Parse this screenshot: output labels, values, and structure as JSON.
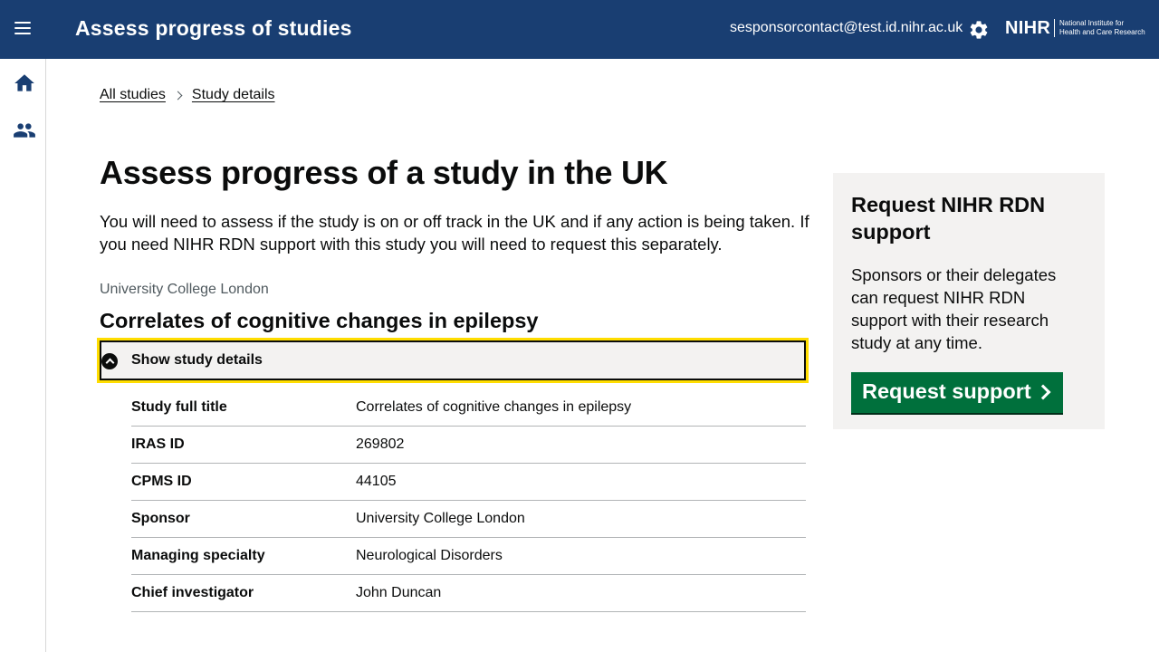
{
  "header": {
    "app_title": "Assess progress of studies",
    "user_email": "sesponsorcontact@test.id.nihr.ac.uk",
    "logo_text": "NIHR",
    "logo_subtitle_line1": "National Institute for",
    "logo_subtitle_line2": "Health and Care Research",
    "icons": [
      "menu-icon",
      "gear-icon"
    ],
    "background_color": "#193e72"
  },
  "siderail": {
    "icons": [
      "home-icon",
      "people-icon"
    ]
  },
  "breadcrumb": {
    "items": [
      "All studies",
      "Study details"
    ]
  },
  "main": {
    "title": "Assess progress of a study in the UK",
    "intro": "You will need to assess if the study is on or off track in the UK and if any action is being taken. If you need NIHR RDN support with this study you will need to request this separately.",
    "organisation": "University College London",
    "study_title": "Correlates of cognitive changes in epilepsy",
    "details_toggle_label": "Show study details",
    "details": [
      {
        "key": "Study full title",
        "value": "Correlates of cognitive changes in epilepsy"
      },
      {
        "key": "IRAS ID",
        "value": "269802"
      },
      {
        "key": "CPMS ID",
        "value": "44105"
      },
      {
        "key": "Sponsor",
        "value": "University College London"
      },
      {
        "key": "Managing specialty",
        "value": "Neurological Disorders"
      },
      {
        "key": "Chief investigator",
        "value": "John Duncan"
      }
    ]
  },
  "aside": {
    "title": "Request NIHR RDN support",
    "text": "Sponsors or their delegates can request NIHR RDN support with their research study at any time.",
    "button_label": "Request support",
    "button_color": "#00703c"
  },
  "colors": {
    "focus_outline": "#ffdd00",
    "panel_background": "#f3f2f1"
  }
}
